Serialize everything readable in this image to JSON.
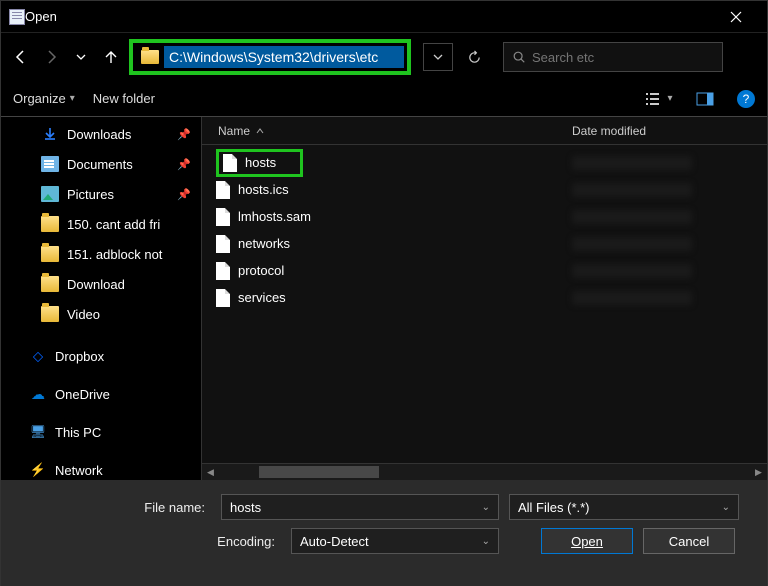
{
  "window": {
    "title": "Open"
  },
  "address": {
    "path": "C:\\Windows\\System32\\drivers\\etc"
  },
  "search": {
    "placeholder": "Search etc"
  },
  "toolbar": {
    "organize": "Organize",
    "new_folder": "New folder"
  },
  "sidebar": {
    "items": [
      {
        "label": "Downloads",
        "icon": "downloads",
        "pinned": true
      },
      {
        "label": "Documents",
        "icon": "documents",
        "pinned": true
      },
      {
        "label": "Pictures",
        "icon": "pictures",
        "pinned": true
      },
      {
        "label": "150. cant add fri",
        "icon": "folder",
        "pinned": false
      },
      {
        "label": "151. adblock not",
        "icon": "folder",
        "pinned": false
      },
      {
        "label": "Download",
        "icon": "folder",
        "pinned": false
      },
      {
        "label": "Video",
        "icon": "folder",
        "pinned": false
      }
    ],
    "groups": [
      {
        "label": "Dropbox",
        "icon": "dropbox"
      },
      {
        "label": "OneDrive",
        "icon": "onedrive"
      },
      {
        "label": "This PC",
        "icon": "pc"
      },
      {
        "label": "Network",
        "icon": "network"
      }
    ]
  },
  "columns": {
    "name": "Name",
    "date": "Date modified"
  },
  "files": [
    {
      "name": "hosts",
      "highlight": true
    },
    {
      "name": "hosts.ics",
      "highlight": false
    },
    {
      "name": "lmhosts.sam",
      "highlight": false
    },
    {
      "name": "networks",
      "highlight": false
    },
    {
      "name": "protocol",
      "highlight": false
    },
    {
      "name": "services",
      "highlight": false
    }
  ],
  "footer": {
    "filename_label": "File name:",
    "filename_value": "hosts",
    "filter_value": "All Files  (*.*)",
    "encoding_label": "Encoding:",
    "encoding_value": "Auto-Detect",
    "open": "Open",
    "cancel": "Cancel"
  }
}
